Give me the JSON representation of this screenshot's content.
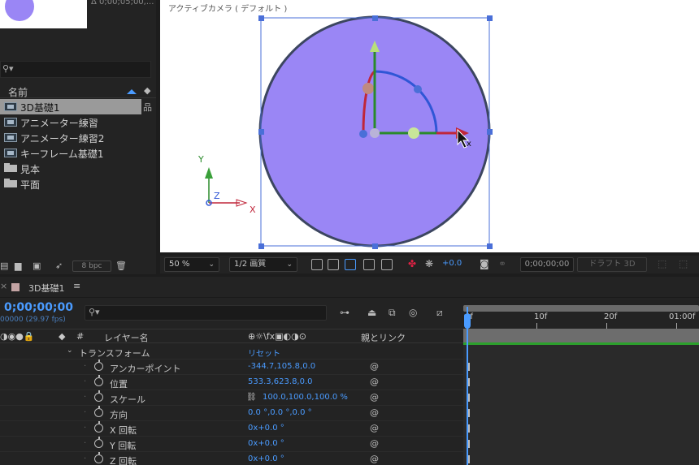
{
  "project": {
    "thumb_info": "Δ 0;00;05;00,...",
    "column_name": "名前",
    "items": [
      {
        "label": "3D基礎1",
        "type": "comp",
        "selected": true
      },
      {
        "label": "アニメーター練習",
        "type": "comp",
        "selected": false
      },
      {
        "label": "アニメーター練習2",
        "type": "comp",
        "selected": false
      },
      {
        "label": "キーフレーム基礎1",
        "type": "comp",
        "selected": false
      },
      {
        "label": "見本",
        "type": "folder",
        "selected": false
      },
      {
        "label": "平面",
        "type": "folder",
        "selected": false
      }
    ],
    "bpc": "8 bpc"
  },
  "viewer": {
    "camera_label": "アクティブカメラ ( デフォルト )",
    "axis_y": "Y",
    "axis_z": "Z",
    "axis_x": "X",
    "gizmo_x": "x",
    "circle_color": "#9a86f5"
  },
  "viewer_toolbar": {
    "zoom": "50 %",
    "resolution": "1/2 画質",
    "exposure": "+0.0",
    "timecode": "0;00;00;00",
    "draft": "ドラフト 3D"
  },
  "timeline": {
    "comp_title": "3D基礎1",
    "timecode": "0;00;00;00",
    "fps": "00000 (29.97 fps)",
    "col_hash": "#",
    "col_layer_name": "レイヤー名",
    "col_parent": "親とリンク",
    "ruler": [
      "0f",
      "10f",
      "20f",
      "01:00f"
    ],
    "transform": {
      "label": "トランスフォーム",
      "reset": "リセット"
    },
    "properties": [
      {
        "name": "アンカーポイント",
        "value": "-344.7,105.8,0.0"
      },
      {
        "name": "位置",
        "value": "533.3,623.8,0.0"
      },
      {
        "name": "スケール",
        "value": "100.0,100.0,100.0 %",
        "linked": true
      },
      {
        "name": "方向",
        "value": "0.0 °,0.0 °,0.0 °"
      },
      {
        "name": "X 回転",
        "value": "0x+0.0 °"
      },
      {
        "name": "Y 回転",
        "value": "0x+0.0 °"
      },
      {
        "name": "Z 回転",
        "value": "0x+0.0 °"
      }
    ]
  },
  "colors": {
    "accent": "#4a9bff",
    "track": "#2ca02c"
  }
}
